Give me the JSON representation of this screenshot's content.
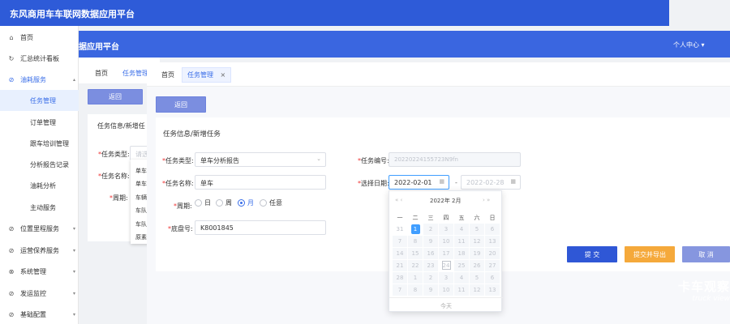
{
  "app_title": "东风商用车车联网数据应用平台",
  "header2": {
    "title": "据应用平台",
    "user": "个人中心"
  },
  "sidebar": {
    "items": [
      {
        "label": "首页",
        "icon": "⌂"
      },
      {
        "label": "汇总统计看板",
        "icon": "↻"
      },
      {
        "label": "油耗服务",
        "icon": "⊘"
      },
      {
        "label": "任务管理"
      },
      {
        "label": "订单管理"
      },
      {
        "label": "跟车培训管理"
      },
      {
        "label": "分析报告记录"
      },
      {
        "label": "油耗分析"
      },
      {
        "label": "主动服务"
      },
      {
        "label": "位置里程服务",
        "icon": "⊘"
      },
      {
        "label": "运营保养服务",
        "icon": "⊘"
      },
      {
        "label": "系统管理",
        "icon": "⊗"
      },
      {
        "label": "发运监控",
        "icon": "⊘"
      },
      {
        "label": "基础配置",
        "icon": "⊘"
      }
    ]
  },
  "layer2": {
    "tabs": [
      "首页",
      "任务管理"
    ],
    "back": "返回",
    "section": "任务信息/新增任",
    "type_label": "任务类型:",
    "type_placeholder": "请选",
    "name_label": "任务名称:",
    "period_label": "周期:",
    "dropdown": [
      "单车",
      "单车",
      "车辆",
      "车队",
      "车队",
      "原素"
    ]
  },
  "main": {
    "tabs": [
      "首页",
      "任务管理"
    ],
    "back": "返回",
    "section_title": "任务信息/新增任务",
    "task_type_label": "任务类型:",
    "task_type_value": "单车分析报告",
    "task_no_label": "任务编号:",
    "task_no_value": "20220224155723N9fn",
    "task_name_label": "任务名称:",
    "task_name_value": "单车",
    "date_label": "选择日期:",
    "start_date": "2022-02-01",
    "end_date": "2022-02-28",
    "range_sep": "-",
    "period_label": "周期:",
    "period_options": [
      "日",
      "周",
      "月",
      "任意"
    ],
    "period_selected": 2,
    "chassis_label": "底盘号:",
    "chassis_value": "K8001845",
    "submit": "提 交",
    "submit_export": "提交并导出",
    "cancel": "取 消"
  },
  "datepicker": {
    "header": "2022年 2月",
    "nav_prev": "« ‹",
    "nav_next": "› »",
    "weekdays": [
      "一",
      "二",
      "三",
      "四",
      "五",
      "六",
      "日"
    ],
    "days": [
      "31",
      "1",
      "2",
      "3",
      "4",
      "5",
      "6",
      "7",
      "8",
      "9",
      "10",
      "11",
      "12",
      "13",
      "14",
      "15",
      "16",
      "17",
      "18",
      "19",
      "20",
      "21",
      "22",
      "23",
      "24",
      "25",
      "26",
      "27",
      "28",
      "1",
      "2",
      "3",
      "4",
      "5",
      "6",
      "7",
      "8",
      "9",
      "10",
      "11",
      "12",
      "13"
    ],
    "selected_index": 1,
    "today_index": 24,
    "footer": "今天"
  },
  "watermark": {
    "cn": "卡车观察",
    "en": "truck view"
  },
  "colors": {
    "header": "#2e5bd8",
    "accent": "#3a6ee8",
    "submit": "#2f57d6",
    "export": "#f5a93b",
    "cancel": "#8696df"
  }
}
